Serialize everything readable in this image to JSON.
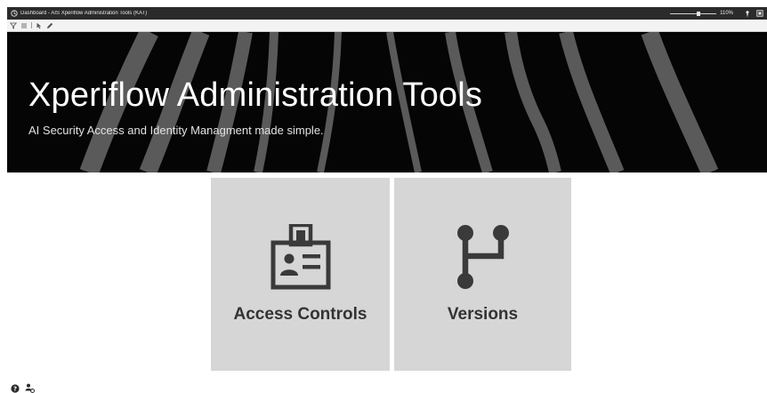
{
  "window": {
    "title": "Dashboard - AIS Xperiflow Administration Tools (KAT)",
    "zoom_level": "110%"
  },
  "toolbar": {
    "tools": [
      "filter-icon",
      "list-icon",
      "pointer-icon",
      "pencil-icon"
    ]
  },
  "banner": {
    "title": "Xperiflow Administration Tools",
    "subtitle": "AI Security Access and Identity Managment made simple."
  },
  "tiles": [
    {
      "label": "Access Controls",
      "icon": "id-badge-icon"
    },
    {
      "label": "Versions",
      "icon": "branch-icon"
    }
  ],
  "footer": {
    "icons": [
      "help-icon",
      "user-settings-icon"
    ]
  },
  "colors": {
    "banner_bg": "#050505",
    "tile_bg": "#d6d6d6",
    "tile_text": "#333333",
    "icon_color": "#3a3a3a"
  }
}
